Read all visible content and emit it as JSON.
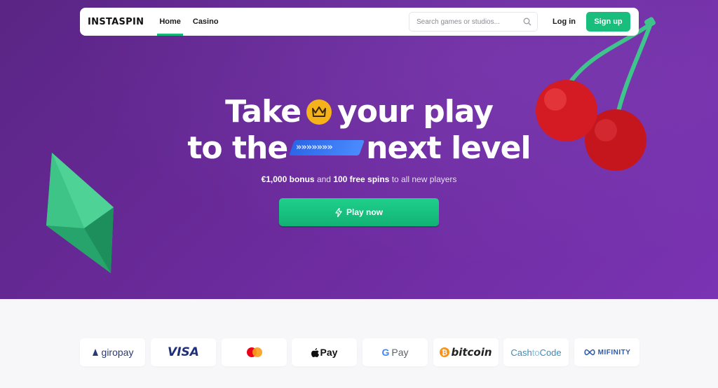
{
  "nav": {
    "logo": "INSTASPIN",
    "links": [
      {
        "label": "Home",
        "active": true
      },
      {
        "label": "Casino",
        "active": false
      }
    ],
    "search_placeholder": "Search games or studios...",
    "login_label": "Log in",
    "signup_label": "Sign up"
  },
  "hero": {
    "line1_a": "Take",
    "line1_b": "your play",
    "line2_a": "to the",
    "line2_b": "next level",
    "arrows": "»»»»»»»",
    "sub_bonus": "€1,000 bonus",
    "sub_and": " and ",
    "sub_spins": "100 free spins",
    "sub_rest": " to all new players",
    "cta_label": "Play now"
  },
  "payments": {
    "items": [
      "giropay",
      "VISA",
      "Mastercard",
      "Pay",
      "Pay",
      "bitcoin",
      "CashtoCode",
      "MIFINITY"
    ],
    "giropay": "giropay",
    "visa": "VISA",
    "apple": "Pay",
    "google": "Pay",
    "bitcoin": "bitcoin",
    "cash": "Cash",
    "to": "to",
    "code": "Code",
    "mifinity": "MIFINITY"
  },
  "colors": {
    "accent": "#19bd7c",
    "hero_bg": "#6a2a9a",
    "crown": "#f5b21b",
    "arrows": "#2a66e6"
  }
}
